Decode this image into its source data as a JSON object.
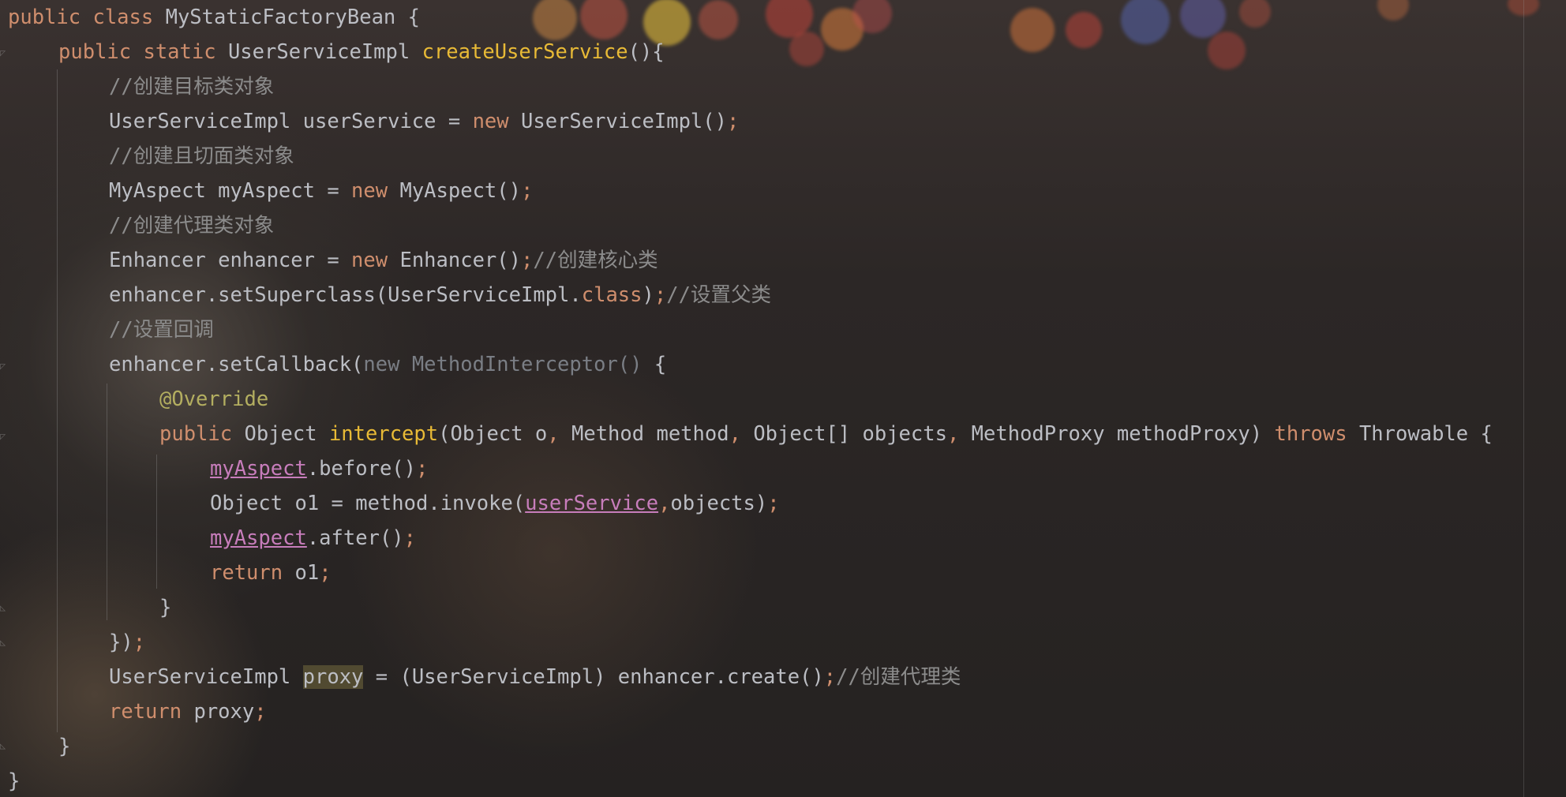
{
  "editor": {
    "theme_colors": {
      "keyword": "#cf8e6d",
      "method_declaration": "#e8ba36",
      "comment": "#8c8c8c",
      "annotation": "#b3ae60",
      "field": "#c77dbb",
      "default_text": "#bcbec4"
    },
    "lines": [
      {
        "segments": [
          [
            "kw",
            "public class "
          ],
          [
            "",
            "MyStaticFactoryBean {"
          ]
        ]
      },
      {
        "segments": [
          [
            "kw",
            "public static "
          ],
          [
            "",
            "UserServiceImpl "
          ],
          [
            "fn",
            "createUserService"
          ],
          [
            "",
            "(){"
          ]
        ]
      },
      {
        "segments": [
          [
            "cm",
            "//创建目标类对象"
          ]
        ]
      },
      {
        "segments": [
          [
            "",
            "UserServiceImpl userService = "
          ],
          [
            "kw",
            "new "
          ],
          [
            "",
            "UserServiceImpl()"
          ],
          [
            "punc",
            ";"
          ]
        ]
      },
      {
        "segments": [
          [
            "cm",
            "//创建且切面类对象"
          ]
        ]
      },
      {
        "segments": [
          [
            "",
            "MyAspect myAspect = "
          ],
          [
            "kw",
            "new "
          ],
          [
            "",
            "MyAspect()"
          ],
          [
            "punc",
            ";"
          ]
        ]
      },
      {
        "segments": [
          [
            "cm",
            "//创建代理类对象"
          ]
        ]
      },
      {
        "segments": [
          [
            "",
            "Enhancer enhancer = "
          ],
          [
            "kw",
            "new "
          ],
          [
            "",
            "Enhancer()"
          ],
          [
            "punc",
            ";"
          ],
          [
            "cm",
            "//创建核心类"
          ]
        ]
      },
      {
        "segments": [
          [
            "",
            "enhancer.setSuperclass(UserServiceImpl."
          ],
          [
            "kw",
            "class"
          ],
          [
            "",
            ")"
          ],
          [
            "punc",
            ";"
          ],
          [
            "cm",
            "//设置父类"
          ]
        ]
      },
      {
        "segments": [
          [
            "cm",
            "//设置回调"
          ]
        ]
      },
      {
        "segments": [
          [
            "",
            "enhancer.setCallback("
          ],
          [
            "dim",
            "new MethodInterceptor() "
          ],
          [
            "",
            "{"
          ]
        ]
      },
      {
        "segments": [
          [
            "an",
            "@Override"
          ]
        ]
      },
      {
        "segments": [
          [
            "kw",
            "public "
          ],
          [
            "",
            "Object "
          ],
          [
            "fn",
            "intercept"
          ],
          [
            "",
            "(Object o"
          ],
          [
            "punc",
            ", "
          ],
          [
            "",
            "Method method"
          ],
          [
            "punc",
            ", "
          ],
          [
            "",
            "Object[] objects"
          ],
          [
            "punc",
            ", "
          ],
          [
            "",
            "MethodProxy methodProxy) "
          ],
          [
            "kw",
            "throws "
          ],
          [
            "",
            "Throwable {"
          ]
        ]
      },
      {
        "segments": [
          [
            "fld",
            "myAspect"
          ],
          [
            "",
            ".before()"
          ],
          [
            "punc",
            ";"
          ]
        ]
      },
      {
        "segments": [
          [
            "",
            "Object o1 = method.invoke("
          ],
          [
            "fld",
            "userService"
          ],
          [
            "punc",
            ","
          ],
          [
            "",
            "objects)"
          ],
          [
            "punc",
            ";"
          ]
        ]
      },
      {
        "segments": [
          [
            "fld",
            "myAspect"
          ],
          [
            "",
            ".after()"
          ],
          [
            "punc",
            ";"
          ]
        ]
      },
      {
        "segments": [
          [
            "kw",
            "return "
          ],
          [
            "",
            "o1"
          ],
          [
            "punc",
            ";"
          ]
        ]
      },
      {
        "segments": [
          [
            "",
            "}"
          ]
        ]
      },
      {
        "segments": [
          [
            "",
            "})"
          ],
          [
            "punc",
            ";"
          ]
        ]
      },
      {
        "segments": [
          [
            "",
            "UserServiceImpl "
          ],
          [
            "hl",
            "proxy"
          ],
          [
            "",
            " = (UserServiceImpl) enhancer.create()"
          ],
          [
            "punc",
            ";"
          ],
          [
            "cm",
            "//创建代理类"
          ]
        ]
      },
      {
        "segments": [
          [
            "kw",
            "return "
          ],
          [
            "",
            "proxy"
          ],
          [
            "punc",
            ";"
          ]
        ]
      },
      {
        "segments": [
          [
            "",
            "}"
          ]
        ]
      },
      {
        "segments": [
          [
            "",
            "}"
          ]
        ]
      }
    ]
  }
}
